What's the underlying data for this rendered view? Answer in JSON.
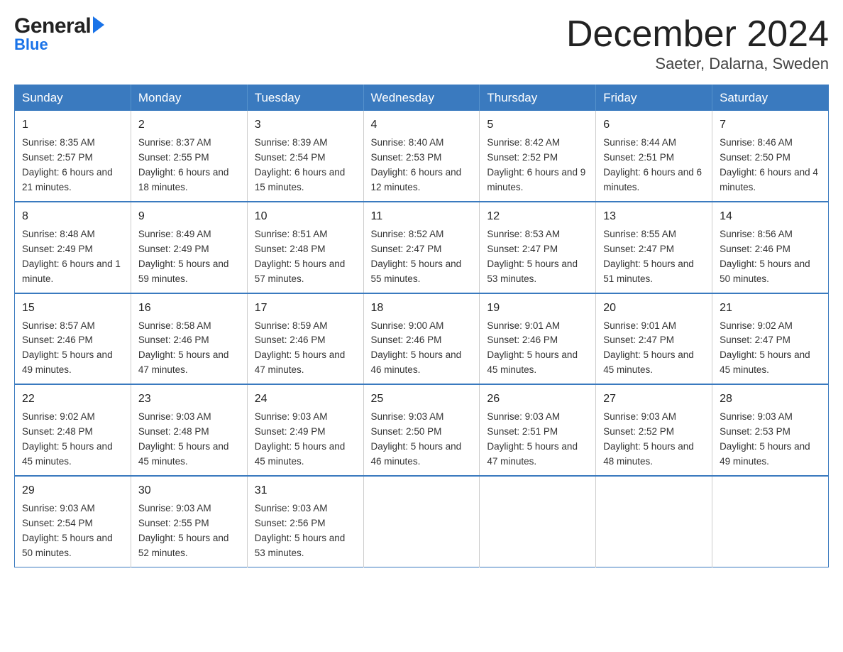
{
  "logo": {
    "general": "General",
    "blue": "Blue"
  },
  "title": "December 2024",
  "subtitle": "Saeter, Dalarna, Sweden",
  "days_of_week": [
    "Sunday",
    "Monday",
    "Tuesday",
    "Wednesday",
    "Thursday",
    "Friday",
    "Saturday"
  ],
  "weeks": [
    [
      {
        "day": "1",
        "sunrise": "8:35 AM",
        "sunset": "2:57 PM",
        "daylight": "6 hours and 21 minutes."
      },
      {
        "day": "2",
        "sunrise": "8:37 AM",
        "sunset": "2:55 PM",
        "daylight": "6 hours and 18 minutes."
      },
      {
        "day": "3",
        "sunrise": "8:39 AM",
        "sunset": "2:54 PM",
        "daylight": "6 hours and 15 minutes."
      },
      {
        "day": "4",
        "sunrise": "8:40 AM",
        "sunset": "2:53 PM",
        "daylight": "6 hours and 12 minutes."
      },
      {
        "day": "5",
        "sunrise": "8:42 AM",
        "sunset": "2:52 PM",
        "daylight": "6 hours and 9 minutes."
      },
      {
        "day": "6",
        "sunrise": "8:44 AM",
        "sunset": "2:51 PM",
        "daylight": "6 hours and 6 minutes."
      },
      {
        "day": "7",
        "sunrise": "8:46 AM",
        "sunset": "2:50 PM",
        "daylight": "6 hours and 4 minutes."
      }
    ],
    [
      {
        "day": "8",
        "sunrise": "8:48 AM",
        "sunset": "2:49 PM",
        "daylight": "6 hours and 1 minute."
      },
      {
        "day": "9",
        "sunrise": "8:49 AM",
        "sunset": "2:49 PM",
        "daylight": "5 hours and 59 minutes."
      },
      {
        "day": "10",
        "sunrise": "8:51 AM",
        "sunset": "2:48 PM",
        "daylight": "5 hours and 57 minutes."
      },
      {
        "day": "11",
        "sunrise": "8:52 AM",
        "sunset": "2:47 PM",
        "daylight": "5 hours and 55 minutes."
      },
      {
        "day": "12",
        "sunrise": "8:53 AM",
        "sunset": "2:47 PM",
        "daylight": "5 hours and 53 minutes."
      },
      {
        "day": "13",
        "sunrise": "8:55 AM",
        "sunset": "2:47 PM",
        "daylight": "5 hours and 51 minutes."
      },
      {
        "day": "14",
        "sunrise": "8:56 AM",
        "sunset": "2:46 PM",
        "daylight": "5 hours and 50 minutes."
      }
    ],
    [
      {
        "day": "15",
        "sunrise": "8:57 AM",
        "sunset": "2:46 PM",
        "daylight": "5 hours and 49 minutes."
      },
      {
        "day": "16",
        "sunrise": "8:58 AM",
        "sunset": "2:46 PM",
        "daylight": "5 hours and 47 minutes."
      },
      {
        "day": "17",
        "sunrise": "8:59 AM",
        "sunset": "2:46 PM",
        "daylight": "5 hours and 47 minutes."
      },
      {
        "day": "18",
        "sunrise": "9:00 AM",
        "sunset": "2:46 PM",
        "daylight": "5 hours and 46 minutes."
      },
      {
        "day": "19",
        "sunrise": "9:01 AM",
        "sunset": "2:46 PM",
        "daylight": "5 hours and 45 minutes."
      },
      {
        "day": "20",
        "sunrise": "9:01 AM",
        "sunset": "2:47 PM",
        "daylight": "5 hours and 45 minutes."
      },
      {
        "day": "21",
        "sunrise": "9:02 AM",
        "sunset": "2:47 PM",
        "daylight": "5 hours and 45 minutes."
      }
    ],
    [
      {
        "day": "22",
        "sunrise": "9:02 AM",
        "sunset": "2:48 PM",
        "daylight": "5 hours and 45 minutes."
      },
      {
        "day": "23",
        "sunrise": "9:03 AM",
        "sunset": "2:48 PM",
        "daylight": "5 hours and 45 minutes."
      },
      {
        "day": "24",
        "sunrise": "9:03 AM",
        "sunset": "2:49 PM",
        "daylight": "5 hours and 45 minutes."
      },
      {
        "day": "25",
        "sunrise": "9:03 AM",
        "sunset": "2:50 PM",
        "daylight": "5 hours and 46 minutes."
      },
      {
        "day": "26",
        "sunrise": "9:03 AM",
        "sunset": "2:51 PM",
        "daylight": "5 hours and 47 minutes."
      },
      {
        "day": "27",
        "sunrise": "9:03 AM",
        "sunset": "2:52 PM",
        "daylight": "5 hours and 48 minutes."
      },
      {
        "day": "28",
        "sunrise": "9:03 AM",
        "sunset": "2:53 PM",
        "daylight": "5 hours and 49 minutes."
      }
    ],
    [
      {
        "day": "29",
        "sunrise": "9:03 AM",
        "sunset": "2:54 PM",
        "daylight": "5 hours and 50 minutes."
      },
      {
        "day": "30",
        "sunrise": "9:03 AM",
        "sunset": "2:55 PM",
        "daylight": "5 hours and 52 minutes."
      },
      {
        "day": "31",
        "sunrise": "9:03 AM",
        "sunset": "2:56 PM",
        "daylight": "5 hours and 53 minutes."
      },
      null,
      null,
      null,
      null
    ]
  ],
  "labels": {
    "sunrise": "Sunrise:",
    "sunset": "Sunset:",
    "daylight": "Daylight:"
  }
}
